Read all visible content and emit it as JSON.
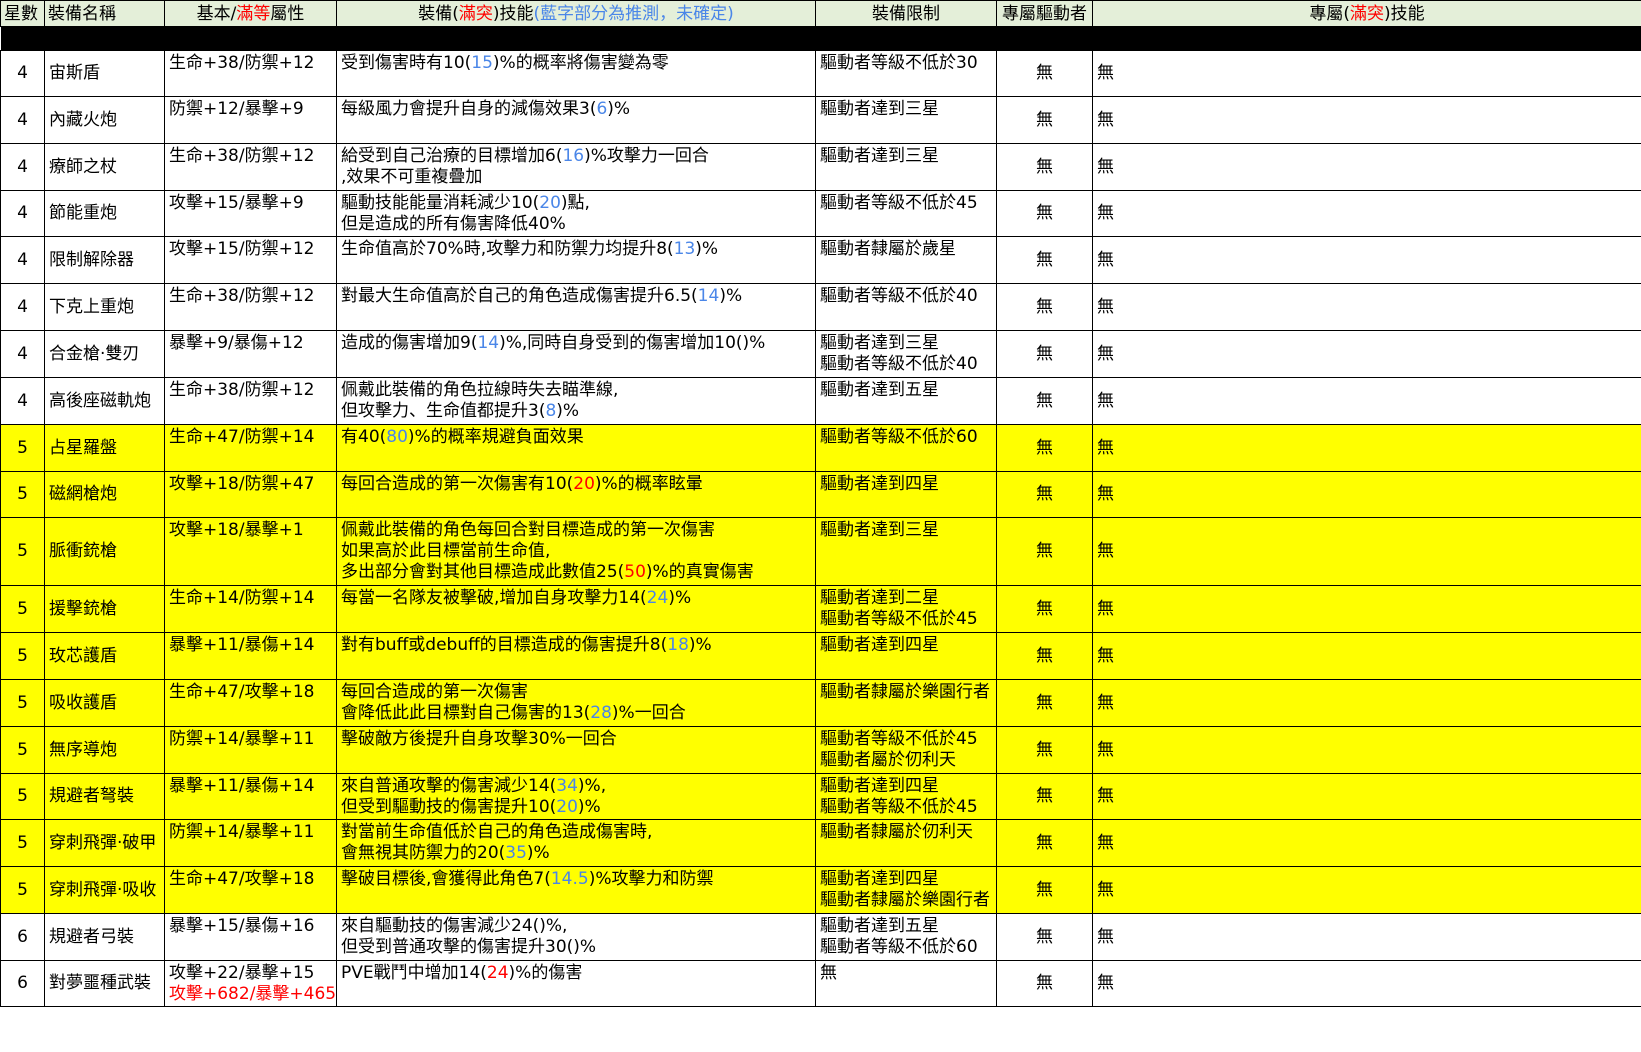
{
  "colors": {
    "header_bg": "#e4efd9",
    "yellow_row": "#ffff00",
    "max_value": "#ff0000",
    "estimated_value": "#4a86e8"
  },
  "headers": {
    "star": "星數",
    "name": "裝備名稱",
    "stat": [
      {
        "t": "基本/",
        "c": ""
      },
      {
        "t": "滿等",
        "c": "red"
      },
      {
        "t": "屬性",
        "c": ""
      }
    ],
    "skill": [
      {
        "t": "裝備(",
        "c": ""
      },
      {
        "t": "滿突",
        "c": "red"
      },
      {
        "t": ")技能",
        "c": ""
      },
      {
        "t": "(藍字部分為推測，未確定)",
        "c": "blue"
      }
    ],
    "limit": "裝備限制",
    "driver": "專屬驅動者",
    "excl": [
      {
        "t": "專屬(",
        "c": ""
      },
      {
        "t": "滿突",
        "c": "red"
      },
      {
        "t": ")技能",
        "c": ""
      }
    ]
  },
  "rows": [
    {
      "star": "4",
      "name": "宙斯盾",
      "hl": false,
      "h": 46,
      "stat": [
        [
          {
            "t": "生命+38/防禦+12"
          }
        ]
      ],
      "skill": [
        [
          {
            "t": "受到傷害時有10("
          },
          {
            "t": "15",
            "c": "blue"
          },
          {
            "t": ")%的概率將傷害變為零"
          }
        ]
      ],
      "limit": [
        "驅動者等級不低於30"
      ],
      "driver": "無",
      "excl": "無"
    },
    {
      "star": "4",
      "name": "內藏火炮",
      "hl": false,
      "h": 47,
      "stat": [
        [
          {
            "t": "防禦+12/暴擊+9"
          }
        ]
      ],
      "skill": [
        [
          {
            "t": "每級風力會提升自身的減傷效果3("
          },
          {
            "t": "6",
            "c": "blue"
          },
          {
            "t": ")%"
          }
        ]
      ],
      "limit": [
        "驅動者達到三星"
      ],
      "driver": "無",
      "excl": "無"
    },
    {
      "star": "4",
      "name": "療師之杖",
      "hl": false,
      "h": 47,
      "stat": [
        [
          {
            "t": "生命+38/防禦+12"
          }
        ]
      ],
      "skill": [
        [
          {
            "t": "給受到自己治療的目標增加6("
          },
          {
            "t": "16",
            "c": "blue"
          },
          {
            "t": ")%攻擊力一回合"
          }
        ],
        [
          {
            "t": ",效果不可重複疊加"
          }
        ]
      ],
      "limit": [
        "驅動者達到三星"
      ],
      "driver": "無",
      "excl": "無"
    },
    {
      "star": "4",
      "name": "節能重炮",
      "hl": false,
      "h": 46,
      "stat": [
        [
          {
            "t": "攻擊+15/暴擊+9"
          }
        ]
      ],
      "skill": [
        [
          {
            "t": "驅動技能能量消耗減少10("
          },
          {
            "t": "20",
            "c": "blue"
          },
          {
            "t": ")點,"
          }
        ],
        [
          {
            "t": "但是造成的所有傷害降低40%"
          }
        ]
      ],
      "limit": [
        "驅動者等級不低於45"
      ],
      "driver": "無",
      "excl": "無"
    },
    {
      "star": "4",
      "name": "限制解除器",
      "hl": false,
      "h": 47,
      "stat": [
        [
          {
            "t": "攻擊+15/防禦+12"
          }
        ]
      ],
      "skill": [
        [
          {
            "t": "生命值高於70%時,攻擊力和防禦力均提升8("
          },
          {
            "t": "13",
            "c": "blue"
          },
          {
            "t": ")%"
          }
        ]
      ],
      "limit": [
        "驅動者隸屬於歲星"
      ],
      "driver": "無",
      "excl": "無"
    },
    {
      "star": "4",
      "name": "下克上重炮",
      "hl": false,
      "h": 47,
      "stat": [
        [
          {
            "t": "生命+38/防禦+12"
          }
        ]
      ],
      "skill": [
        [
          {
            "t": "對最大生命值高於自己的角色造成傷害提升6.5("
          },
          {
            "t": "14",
            "c": "blue"
          },
          {
            "t": ")%"
          }
        ]
      ],
      "limit": [
        "驅動者等級不低於40"
      ],
      "driver": "無",
      "excl": "無"
    },
    {
      "star": "4",
      "name": "合金槍·雙刃",
      "hl": false,
      "h": 47,
      "stat": [
        [
          {
            "t": "暴擊+9/暴傷+12"
          }
        ]
      ],
      "skill": [
        [
          {
            "t": "造成的傷害增加9("
          },
          {
            "t": "14",
            "c": "blue"
          },
          {
            "t": ")%,同時自身受到的傷害增加10()%"
          }
        ]
      ],
      "limit": [
        "驅動者達到三星",
        "驅動者等級不低於40"
      ],
      "driver": "無",
      "excl": "無"
    },
    {
      "star": "4",
      "name": "高後座磁軌炮",
      "hl": false,
      "h": 47,
      "stat": [
        [
          {
            "t": "生命+38/防禦+12"
          }
        ]
      ],
      "skill": [
        [
          {
            "t": "佩戴此裝備的角色拉線時失去瞄準線,"
          }
        ],
        [
          {
            "t": "但攻擊力、生命值都提升3("
          },
          {
            "t": "8",
            "c": "blue"
          },
          {
            "t": ")%"
          }
        ]
      ],
      "limit": [
        "驅動者達到五星"
      ],
      "driver": "無",
      "excl": "無"
    },
    {
      "star": "5",
      "name": "占星羅盤",
      "hl": true,
      "h": 47,
      "stat": [
        [
          {
            "t": "生命+47/防禦+14"
          }
        ]
      ],
      "skill": [
        [
          {
            "t": "有40("
          },
          {
            "t": "80",
            "c": "blue"
          },
          {
            "t": ")%的概率規避負面效果"
          }
        ]
      ],
      "limit": [
        "驅動者等級不低於60"
      ],
      "driver": "無",
      "excl": "無"
    },
    {
      "star": "5",
      "name": "磁網槍炮",
      "hl": true,
      "h": 46,
      "stat": [
        [
          {
            "t": "攻擊+18/防禦+47"
          }
        ]
      ],
      "skill": [
        [
          {
            "t": "每回合造成的第一次傷害有10("
          },
          {
            "t": "20",
            "c": "red"
          },
          {
            "t": ")%的概率眩暈"
          }
        ]
      ],
      "limit": [
        "驅動者達到四星"
      ],
      "driver": "無",
      "excl": "無"
    },
    {
      "star": "5",
      "name": "脈衝銃槍",
      "hl": true,
      "h": 68,
      "stat": [
        [
          {
            "t": "攻擊+18/暴擊+1"
          }
        ]
      ],
      "skill": [
        [
          {
            "t": "佩戴此裝備的角色每回合對目標造成的第一次傷害"
          }
        ],
        [
          {
            "t": "如果高於此目標當前生命值,"
          }
        ],
        [
          {
            "t": "多出部分會對其他目標造成此數值25("
          },
          {
            "t": "50",
            "c": "red"
          },
          {
            "t": ")%的真實傷害"
          }
        ]
      ],
      "limit": [
        "驅動者達到三星"
      ],
      "driver": "無",
      "excl": "無"
    },
    {
      "star": "5",
      "name": "援擊銃槍",
      "hl": true,
      "h": 47,
      "stat": [
        [
          {
            "t": "生命+14/防禦+14"
          }
        ]
      ],
      "skill": [
        [
          {
            "t": "每當一名隊友被擊破,增加自身攻擊力14("
          },
          {
            "t": "24",
            "c": "blue"
          },
          {
            "t": ")%"
          }
        ]
      ],
      "limit": [
        "驅動者達到二星",
        "驅動者等級不低於45"
      ],
      "driver": "無",
      "excl": "無"
    },
    {
      "star": "5",
      "name": "玫芯護盾",
      "hl": true,
      "h": 47,
      "stat": [
        [
          {
            "t": "暴擊+11/暴傷+14"
          }
        ]
      ],
      "skill": [
        [
          {
            "t": "對有buff或debuff的目標造成的傷害提升8("
          },
          {
            "t": "18",
            "c": "blue"
          },
          {
            "t": ")%"
          }
        ]
      ],
      "limit": [
        "驅動者達到四星"
      ],
      "driver": "無",
      "excl": "無"
    },
    {
      "star": "5",
      "name": "吸收護盾",
      "hl": true,
      "h": 47,
      "stat": [
        [
          {
            "t": "生命+47/攻擊+18"
          }
        ]
      ],
      "skill": [
        [
          {
            "t": "每回合造成的第一次傷害"
          }
        ],
        [
          {
            "t": "會降低此此目標對自己傷害的13("
          },
          {
            "t": "28",
            "c": "blue"
          },
          {
            "t": ")%一回合"
          }
        ]
      ],
      "limit": [
        "驅動者隸屬於樂園行者"
      ],
      "driver": "無",
      "excl": "無"
    },
    {
      "star": "5",
      "name": "無序導炮",
      "hl": true,
      "h": 47,
      "stat": [
        [
          {
            "t": "防禦+14/暴擊+11"
          }
        ]
      ],
      "skill": [
        [
          {
            "t": "擊破敵方後提升自身攻擊30%一回合"
          }
        ]
      ],
      "limit": [
        "驅動者等級不低於45",
        "驅動者屬於仞利天"
      ],
      "driver": "無",
      "excl": "無"
    },
    {
      "star": "5",
      "name": "規避者弩裝",
      "hl": true,
      "h": 46,
      "stat": [
        [
          {
            "t": "暴擊+11/暴傷+14"
          }
        ]
      ],
      "skill": [
        [
          {
            "t": "來自普通攻擊的傷害減少14("
          },
          {
            "t": "34",
            "c": "blue"
          },
          {
            "t": ")%,"
          }
        ],
        [
          {
            "t": "但受到驅動技的傷害提升10("
          },
          {
            "t": "20",
            "c": "blue"
          },
          {
            "t": ")%"
          }
        ]
      ],
      "limit": [
        "驅動者達到四星",
        "驅動者等級不低於45"
      ],
      "driver": "無",
      "excl": "無"
    },
    {
      "star": "5",
      "name": "穿刺飛彈·破甲",
      "hl": true,
      "h": 47,
      "stat": [
        [
          {
            "t": "防禦+14/暴擊+11"
          }
        ]
      ],
      "skill": [
        [
          {
            "t": "對當前生命值低於自己的角色造成傷害時,"
          }
        ],
        [
          {
            "t": "會無視其防禦力的20("
          },
          {
            "t": "35",
            "c": "blue"
          },
          {
            "t": ")%"
          }
        ]
      ],
      "limit": [
        "驅動者隸屬於仞利天"
      ],
      "driver": "無",
      "excl": "無"
    },
    {
      "star": "5",
      "name": "穿刺飛彈·吸收",
      "hl": true,
      "h": 47,
      "stat": [
        [
          {
            "t": "生命+47/攻擊+18"
          }
        ]
      ],
      "skill": [
        [
          {
            "t": "擊破目標後,會獲得此角色7("
          },
          {
            "t": "14.5",
            "c": "blue"
          },
          {
            "t": ")%攻擊力和防禦"
          }
        ]
      ],
      "limit": [
        "驅動者達到四星",
        "驅動者隸屬於樂園行者"
      ],
      "driver": "無",
      "excl": "無"
    },
    {
      "star": "6",
      "name": "規避者弓裝",
      "hl": false,
      "h": 47,
      "stat": [
        [
          {
            "t": "暴擊+15/暴傷+16"
          }
        ]
      ],
      "skill": [
        [
          {
            "t": "來自驅動技的傷害減少24()%,"
          }
        ],
        [
          {
            "t": "但受到普通攻擊的傷害提升30()%"
          }
        ]
      ],
      "limit": [
        "驅動者達到五星",
        "驅動者等級不低於60"
      ],
      "driver": "無",
      "excl": "無"
    },
    {
      "star": "6",
      "name": "對夢噩種武裝",
      "hl": false,
      "h": 46,
      "stat": [
        [
          {
            "t": "攻擊+22/暴擊+15"
          }
        ],
        [
          {
            "t": "攻擊+682/暴擊+465",
            "c": "red"
          }
        ]
      ],
      "skill": [
        [
          {
            "t": "PVE戰鬥中增加14("
          },
          {
            "t": "24",
            "c": "red"
          },
          {
            "t": ")%的傷害"
          }
        ]
      ],
      "limit": [
        "無"
      ],
      "driver": "無",
      "excl": "無"
    }
  ]
}
